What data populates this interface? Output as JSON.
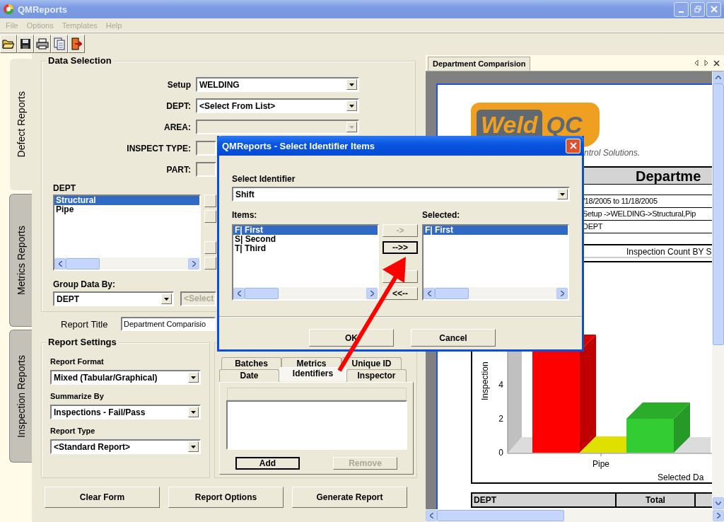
{
  "window": {
    "title": "QMReports"
  },
  "menu": [
    {
      "label": "File",
      "disabled": true
    },
    {
      "label": "Options",
      "disabled": true
    },
    {
      "label": "Templates",
      "disabled": true
    },
    {
      "label": "Help",
      "disabled": true
    }
  ],
  "toolbar": [
    {
      "kind": "open"
    },
    {
      "kind": "save"
    },
    {
      "kind": "print"
    },
    {
      "kind": "document"
    },
    {
      "kind": "exit"
    }
  ],
  "side_tabs": [
    {
      "label": "Defect Reports",
      "selected": true
    },
    {
      "label": "Metrics Reports",
      "selected": false
    },
    {
      "label": "Inspection Reports",
      "selected": false
    }
  ],
  "data_selection": {
    "title": "Data Selection",
    "fields": [
      {
        "label": "Setup",
        "value": "WELDING",
        "kind": "combo",
        "disabled": false
      },
      {
        "label": "DEPT:",
        "value": "<Select From List>",
        "kind": "combo",
        "disabled": false
      },
      {
        "label": "AREA:",
        "kind": "combo",
        "disabled": true
      },
      {
        "label": "INSPECT TYPE:",
        "kind": "text",
        "disabled": true
      },
      {
        "label": "PART:",
        "kind": "text",
        "disabled": true
      }
    ],
    "list": {
      "label": "DEPT",
      "items": [
        {
          "text": "Structural",
          "selected": true
        },
        {
          "text": "Pipe",
          "selected": false
        }
      ]
    },
    "group_by": {
      "label": "Group Data By:",
      "value": "DEPT",
      "secondary": "<Select"
    }
  },
  "report_title": {
    "label": "Report Title",
    "value": "Department Comparisio"
  },
  "report_settings": {
    "title": "Report Settings",
    "fields": [
      {
        "label": "Report Format",
        "value": "Mixed (Tabular/Graphical)"
      },
      {
        "label": "Summarize By",
        "value": "Inspections - Fail/Pass"
      },
      {
        "label": "Report Type",
        "value": "<Standard Report>"
      }
    ]
  },
  "filter_tabs": {
    "rows": [
      [
        {
          "label": "Batches",
          "selected": false
        },
        {
          "label": "Metrics",
          "selected": false
        },
        {
          "label": "Unique ID",
          "selected": false
        }
      ],
      [
        {
          "label": "Date",
          "selected": false
        },
        {
          "label": "Identifiers",
          "selected": true
        },
        {
          "label": "Inspector",
          "selected": false
        }
      ]
    ],
    "buttons": [
      {
        "label": "Add",
        "disabled": false,
        "focused": true
      },
      {
        "label": "Remove",
        "disabled": true,
        "focused": false
      }
    ]
  },
  "actions": [
    "Clear Form",
    "Report Options",
    "Generate Report"
  ],
  "report": {
    "tab": "Department Comparision",
    "logo": [
      "Weld",
      "QC"
    ],
    "tagline": "ntrol Solutions.",
    "heading": "Departme",
    "info_rows": [
      "/18/2005 to 11/18/2005",
      "Setup ->WELDING->Structural,Pip",
      "DEPT"
    ],
    "chart_caption": "Inspection Count BY S",
    "chart_data": {
      "type": "bar",
      "ylabel": "Inspection",
      "xlabel": "Selected Da",
      "categories": [
        "Pipe"
      ],
      "series": [
        {
          "color": "#ff0000",
          "values": [
            6
          ]
        },
        {
          "color": "#e0e000",
          "values": [
            0
          ]
        },
        {
          "color": "#33cc33",
          "values": [
            2
          ]
        }
      ],
      "yticks": [
        0,
        2,
        4
      ],
      "ylim": [
        0,
        10
      ]
    },
    "table": {
      "columns": [
        "DEPT",
        "Total"
      ]
    }
  },
  "dialog": {
    "title": "QMReports - Select Identifier Items",
    "identifier": {
      "label": "Select Identifier",
      "value": "Shift"
    },
    "items": {
      "label": "Items:",
      "options": [
        {
          "text": "F| First",
          "selected": true
        },
        {
          "text": "S| Second",
          "selected": false
        },
        {
          "text": "T| Third",
          "selected": false
        }
      ]
    },
    "move_buttons": [
      {
        "label": "->",
        "disabled": true,
        "focused": false
      },
      {
        "label": "-->>",
        "disabled": false,
        "focused": true
      },
      {
        "focused": false
      },
      {
        "label": "<<--",
        "disabled": false,
        "focused": false
      }
    ],
    "selected": {
      "label": "Selected:",
      "options": [
        {
          "text": "F| First",
          "selected": true
        }
      ]
    },
    "buttons": [
      "OK",
      "Cancel"
    ]
  }
}
